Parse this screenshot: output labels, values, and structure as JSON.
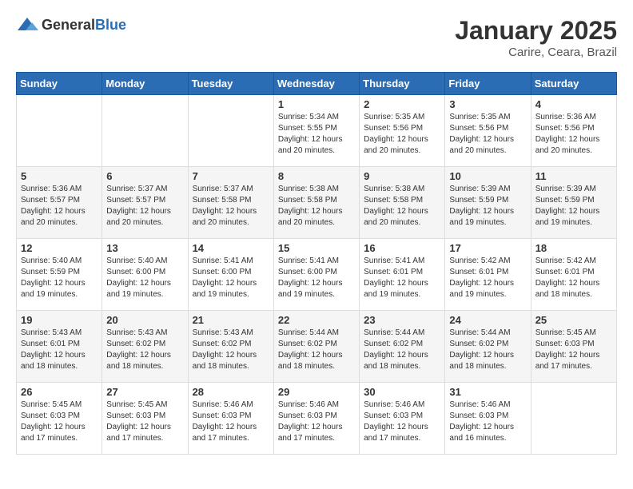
{
  "logo": {
    "general": "General",
    "blue": "Blue"
  },
  "header": {
    "month": "January 2025",
    "location": "Carire, Ceara, Brazil"
  },
  "weekdays": [
    "Sunday",
    "Monday",
    "Tuesday",
    "Wednesday",
    "Thursday",
    "Friday",
    "Saturday"
  ],
  "weeks": [
    [
      {
        "day": "",
        "info": ""
      },
      {
        "day": "",
        "info": ""
      },
      {
        "day": "",
        "info": ""
      },
      {
        "day": "1",
        "info": "Sunrise: 5:34 AM\nSunset: 5:55 PM\nDaylight: 12 hours\nand 20 minutes."
      },
      {
        "day": "2",
        "info": "Sunrise: 5:35 AM\nSunset: 5:56 PM\nDaylight: 12 hours\nand 20 minutes."
      },
      {
        "day": "3",
        "info": "Sunrise: 5:35 AM\nSunset: 5:56 PM\nDaylight: 12 hours\nand 20 minutes."
      },
      {
        "day": "4",
        "info": "Sunrise: 5:36 AM\nSunset: 5:56 PM\nDaylight: 12 hours\nand 20 minutes."
      }
    ],
    [
      {
        "day": "5",
        "info": "Sunrise: 5:36 AM\nSunset: 5:57 PM\nDaylight: 12 hours\nand 20 minutes."
      },
      {
        "day": "6",
        "info": "Sunrise: 5:37 AM\nSunset: 5:57 PM\nDaylight: 12 hours\nand 20 minutes."
      },
      {
        "day": "7",
        "info": "Sunrise: 5:37 AM\nSunset: 5:58 PM\nDaylight: 12 hours\nand 20 minutes."
      },
      {
        "day": "8",
        "info": "Sunrise: 5:38 AM\nSunset: 5:58 PM\nDaylight: 12 hours\nand 20 minutes."
      },
      {
        "day": "9",
        "info": "Sunrise: 5:38 AM\nSunset: 5:58 PM\nDaylight: 12 hours\nand 20 minutes."
      },
      {
        "day": "10",
        "info": "Sunrise: 5:39 AM\nSunset: 5:59 PM\nDaylight: 12 hours\nand 19 minutes."
      },
      {
        "day": "11",
        "info": "Sunrise: 5:39 AM\nSunset: 5:59 PM\nDaylight: 12 hours\nand 19 minutes."
      }
    ],
    [
      {
        "day": "12",
        "info": "Sunrise: 5:40 AM\nSunset: 5:59 PM\nDaylight: 12 hours\nand 19 minutes."
      },
      {
        "day": "13",
        "info": "Sunrise: 5:40 AM\nSunset: 6:00 PM\nDaylight: 12 hours\nand 19 minutes."
      },
      {
        "day": "14",
        "info": "Sunrise: 5:41 AM\nSunset: 6:00 PM\nDaylight: 12 hours\nand 19 minutes."
      },
      {
        "day": "15",
        "info": "Sunrise: 5:41 AM\nSunset: 6:00 PM\nDaylight: 12 hours\nand 19 minutes."
      },
      {
        "day": "16",
        "info": "Sunrise: 5:41 AM\nSunset: 6:01 PM\nDaylight: 12 hours\nand 19 minutes."
      },
      {
        "day": "17",
        "info": "Sunrise: 5:42 AM\nSunset: 6:01 PM\nDaylight: 12 hours\nand 19 minutes."
      },
      {
        "day": "18",
        "info": "Sunrise: 5:42 AM\nSunset: 6:01 PM\nDaylight: 12 hours\nand 18 minutes."
      }
    ],
    [
      {
        "day": "19",
        "info": "Sunrise: 5:43 AM\nSunset: 6:01 PM\nDaylight: 12 hours\nand 18 minutes."
      },
      {
        "day": "20",
        "info": "Sunrise: 5:43 AM\nSunset: 6:02 PM\nDaylight: 12 hours\nand 18 minutes."
      },
      {
        "day": "21",
        "info": "Sunrise: 5:43 AM\nSunset: 6:02 PM\nDaylight: 12 hours\nand 18 minutes."
      },
      {
        "day": "22",
        "info": "Sunrise: 5:44 AM\nSunset: 6:02 PM\nDaylight: 12 hours\nand 18 minutes."
      },
      {
        "day": "23",
        "info": "Sunrise: 5:44 AM\nSunset: 6:02 PM\nDaylight: 12 hours\nand 18 minutes."
      },
      {
        "day": "24",
        "info": "Sunrise: 5:44 AM\nSunset: 6:02 PM\nDaylight: 12 hours\nand 18 minutes."
      },
      {
        "day": "25",
        "info": "Sunrise: 5:45 AM\nSunset: 6:03 PM\nDaylight: 12 hours\nand 17 minutes."
      }
    ],
    [
      {
        "day": "26",
        "info": "Sunrise: 5:45 AM\nSunset: 6:03 PM\nDaylight: 12 hours\nand 17 minutes."
      },
      {
        "day": "27",
        "info": "Sunrise: 5:45 AM\nSunset: 6:03 PM\nDaylight: 12 hours\nand 17 minutes."
      },
      {
        "day": "28",
        "info": "Sunrise: 5:46 AM\nSunset: 6:03 PM\nDaylight: 12 hours\nand 17 minutes."
      },
      {
        "day": "29",
        "info": "Sunrise: 5:46 AM\nSunset: 6:03 PM\nDaylight: 12 hours\nand 17 minutes."
      },
      {
        "day": "30",
        "info": "Sunrise: 5:46 AM\nSunset: 6:03 PM\nDaylight: 12 hours\nand 17 minutes."
      },
      {
        "day": "31",
        "info": "Sunrise: 5:46 AM\nSunset: 6:03 PM\nDaylight: 12 hours\nand 16 minutes."
      },
      {
        "day": "",
        "info": ""
      }
    ]
  ]
}
